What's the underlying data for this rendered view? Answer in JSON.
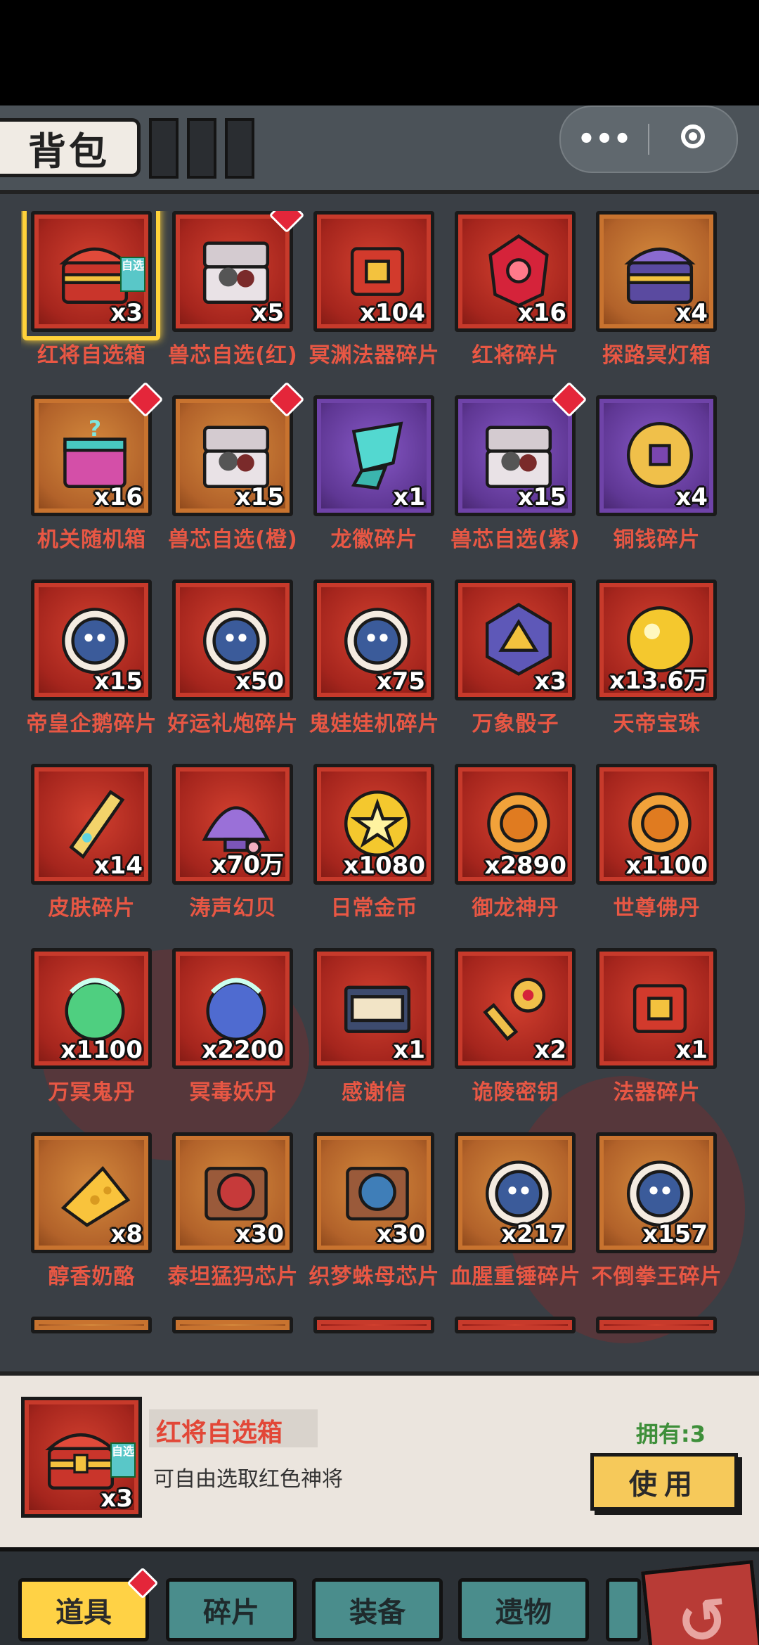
{
  "header": {
    "title": "背包",
    "more_label": "•••"
  },
  "colors": {
    "item_name": "#e85744",
    "owned_green": "#3e8f3a",
    "active_tab": "#ffd245",
    "inactive_tab": "#4a8d8c"
  },
  "items": [
    {
      "name": "红将自选箱",
      "count": "x3",
      "color": "red",
      "icon": "chest-icon",
      "selected": true,
      "badge": false,
      "tag": "自选"
    },
    {
      "name": "兽芯自选(红)",
      "count": "x5",
      "color": "red",
      "icon": "open-chest-icon",
      "badge": true
    },
    {
      "name": "冥渊法器碎片",
      "count": "x104",
      "color": "red",
      "icon": "artifact-fragment-icon",
      "badge": false
    },
    {
      "name": "红将碎片",
      "count": "x16",
      "color": "red",
      "icon": "red-gem-icon",
      "badge": false
    },
    {
      "name": "探路冥灯箱",
      "count": "x4",
      "color": "orange",
      "icon": "lamp-chest-icon",
      "badge": false
    },
    {
      "name": "机关随机箱",
      "count": "x16",
      "color": "orange",
      "icon": "mystery-box-icon",
      "badge": true
    },
    {
      "name": "兽芯自选(橙)",
      "count": "x15",
      "color": "orange",
      "icon": "open-chest-icon",
      "badge": true
    },
    {
      "name": "龙徽碎片",
      "count": "x1",
      "color": "purple",
      "icon": "dragon-badge-fragment-icon",
      "badge": false
    },
    {
      "name": "兽芯自选(紫)",
      "count": "x15",
      "color": "purple",
      "icon": "open-chest-icon",
      "badge": true
    },
    {
      "name": "铜钱碎片",
      "count": "x4",
      "color": "purple",
      "icon": "coin-fragment-icon",
      "badge": false
    },
    {
      "name": "帝皇企鹅碎片",
      "count": "x15",
      "color": "red",
      "icon": "penguin-portrait-icon",
      "badge": false
    },
    {
      "name": "好运礼炮碎片",
      "count": "x50",
      "color": "red",
      "icon": "cannon-portrait-icon",
      "badge": false
    },
    {
      "name": "鬼娃娃机碎片",
      "count": "x75",
      "color": "red",
      "icon": "claw-machine-portrait-icon",
      "badge": false
    },
    {
      "name": "万象骰子",
      "count": "x3",
      "color": "red",
      "icon": "dice-icon",
      "badge": false
    },
    {
      "name": "天帝宝珠",
      "count": "x13.6万",
      "color": "red",
      "icon": "golden-orb-icon",
      "badge": false
    },
    {
      "name": "皮肤碎片",
      "count": "x14",
      "color": "red",
      "icon": "skin-fragment-icon",
      "badge": false
    },
    {
      "name": "涛声幻贝",
      "count": "x70万",
      "color": "red",
      "icon": "shell-icon",
      "badge": false
    },
    {
      "name": "日常金币",
      "count": "x1080",
      "color": "red",
      "icon": "star-coin-icon",
      "badge": false
    },
    {
      "name": "御龙神丹",
      "count": "x2890",
      "color": "red",
      "icon": "dragon-pill-icon",
      "badge": false
    },
    {
      "name": "世尊佛丹",
      "count": "x1100",
      "color": "red",
      "icon": "buddha-pill-icon",
      "badge": false
    },
    {
      "name": "万冥鬼丹",
      "count": "x1100",
      "color": "red",
      "icon": "ghost-pill-icon",
      "badge": false
    },
    {
      "name": "冥毒妖丹",
      "count": "x2200",
      "color": "red",
      "icon": "demon-pill-icon",
      "badge": false
    },
    {
      "name": "感谢信",
      "count": "x1",
      "color": "red",
      "icon": "letter-icon",
      "badge": false
    },
    {
      "name": "诡陵密钥",
      "count": "x2",
      "color": "red",
      "icon": "key-icon",
      "badge": false
    },
    {
      "name": "法器碎片",
      "count": "x1",
      "color": "red",
      "icon": "artifact-piece-icon",
      "badge": false
    },
    {
      "name": "醇香奶酪",
      "count": "x8",
      "color": "orange",
      "icon": "cheese-icon",
      "badge": false
    },
    {
      "name": "泰坦猛犸芯片",
      "count": "x30",
      "color": "orange",
      "icon": "mammoth-chip-icon",
      "badge": false
    },
    {
      "name": "织梦蛛母芯片",
      "count": "x30",
      "color": "orange",
      "icon": "spider-chip-icon",
      "badge": false
    },
    {
      "name": "血腥重锤碎片",
      "count": "x217",
      "color": "orange",
      "icon": "hammer-portrait-icon",
      "badge": false
    },
    {
      "name": "不倒拳王碎片",
      "count": "x157",
      "color": "orange",
      "icon": "boxer-portrait-icon",
      "badge": false
    }
  ],
  "detail": {
    "name": "红将自选箱",
    "description": "可自由选取红色神将",
    "count": "x3",
    "tag": "自选",
    "owned": "拥有:3",
    "use_label": "使用"
  },
  "tabs": [
    {
      "label": "道具",
      "active": true,
      "badge": true
    },
    {
      "label": "碎片",
      "active": false,
      "badge": false
    },
    {
      "label": "装备",
      "active": false,
      "badge": false
    },
    {
      "label": "遗物",
      "active": false,
      "badge": false
    }
  ]
}
